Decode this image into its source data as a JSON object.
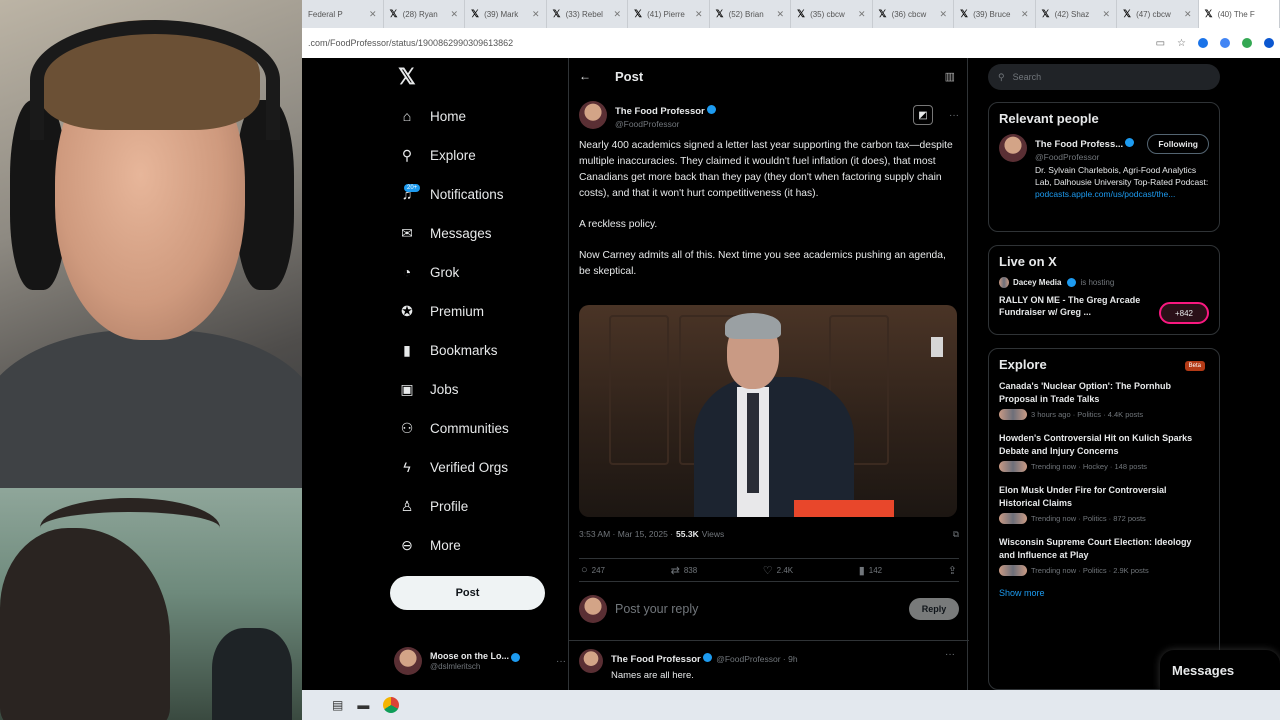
{
  "browser": {
    "tabs": [
      {
        "title": "Federal P"
      },
      {
        "title": "(28) Ryan"
      },
      {
        "title": "(39) Mark"
      },
      {
        "title": "(33) Rebel"
      },
      {
        "title": "(41) Pierre"
      },
      {
        "title": "(52) Brian"
      },
      {
        "title": "(35) cbcw"
      },
      {
        "title": "(36) cbcw"
      },
      {
        "title": "(39) Bruce"
      },
      {
        "title": "(42) Shaz"
      },
      {
        "title": "(47) cbcw"
      },
      {
        "title": "(40) The F"
      }
    ],
    "url": ".com/FoodProfessor/status/1900862990309613862"
  },
  "nav": {
    "items": [
      {
        "label": "Home",
        "icon": "home-icon"
      },
      {
        "label": "Explore",
        "icon": "search-icon"
      },
      {
        "label": "Notifications",
        "icon": "bell-icon",
        "badge": "20+"
      },
      {
        "label": "Messages",
        "icon": "mail-icon"
      },
      {
        "label": "Grok",
        "icon": "grok-icon"
      },
      {
        "label": "Premium",
        "icon": "premium-icon"
      },
      {
        "label": "Bookmarks",
        "icon": "bookmark-icon"
      },
      {
        "label": "Jobs",
        "icon": "briefcase-icon"
      },
      {
        "label": "Communities",
        "icon": "people-icon"
      },
      {
        "label": "Verified Orgs",
        "icon": "lightning-icon"
      },
      {
        "label": "Profile",
        "icon": "person-icon"
      },
      {
        "label": "More",
        "icon": "more-circle-icon"
      }
    ],
    "post_label": "Post",
    "account": {
      "name": "Moose on the Lo...",
      "handle": "@dslmleritsch"
    }
  },
  "post": {
    "header": "Post",
    "author": {
      "name": "The Food Professor",
      "handle": "@FoodProfessor"
    },
    "paragraphs": [
      "Nearly 400 academics signed a letter last year supporting the carbon tax—despite multiple inaccuracies. They claimed it wouldn't fuel inflation (it does), that most Canadians get more back than they pay (they don't when factoring supply chain costs), and that it won't hurt competitiveness (it has).",
      "A reckless policy.",
      "Now Carney admits all of this. Next time you see academics pushing an agenda, be skeptical."
    ],
    "timestamp": "3:53 AM · Mar 15, 2025 ·",
    "views_count": "55.3K",
    "views_label": "Views",
    "replies": "247",
    "reposts": "838",
    "likes": "2.4K",
    "bookmarks": "142",
    "reply_placeholder": "Post your reply",
    "reply_button": "Reply"
  },
  "reply_tweet": {
    "name": "The Food Professor",
    "handle": "@FoodProfessor · 9h",
    "text": "Names are all here."
  },
  "sidebar": {
    "search_placeholder": "Search",
    "relevant": {
      "title": "Relevant people",
      "name": "The Food Profess...",
      "handle": "@FoodProfessor",
      "follow_label": "Following",
      "bio": "Dr. Sylvain Charlebois, Agri-Food Analytics Lab, Dalhousie University Top-Rated Podcast:",
      "link": "podcasts.apple.com/us/podcast/the..."
    },
    "live": {
      "title": "Live on X",
      "host": "Dacey Media",
      "status": "is hosting",
      "space_title": "RALLY ON ME - The Greg Arcade Fundraiser w/ Greg ...",
      "listeners": "+842"
    },
    "explore": {
      "title": "Explore",
      "beta": "Beta",
      "trends": [
        {
          "title": "Canada's 'Nuclear Option': The Pornhub Proposal in Trade Talks",
          "meta": "3 hours ago · Politics · 4.4K posts"
        },
        {
          "title": "Howden's Controversial Hit on Kulich Sparks Debate and Injury Concerns",
          "meta": "Trending now · Hockey · 148 posts"
        },
        {
          "title": "Elon Musk Under Fire for Controversial Historical Claims",
          "meta": "Trending now · Politics · 872 posts"
        },
        {
          "title": "Wisconsin Supreme Court Election: Ideology and Influence at Play",
          "meta": "Trending now · Politics · 2.9K posts"
        }
      ],
      "show_more": "Show more"
    },
    "messages_label": "Messages"
  }
}
